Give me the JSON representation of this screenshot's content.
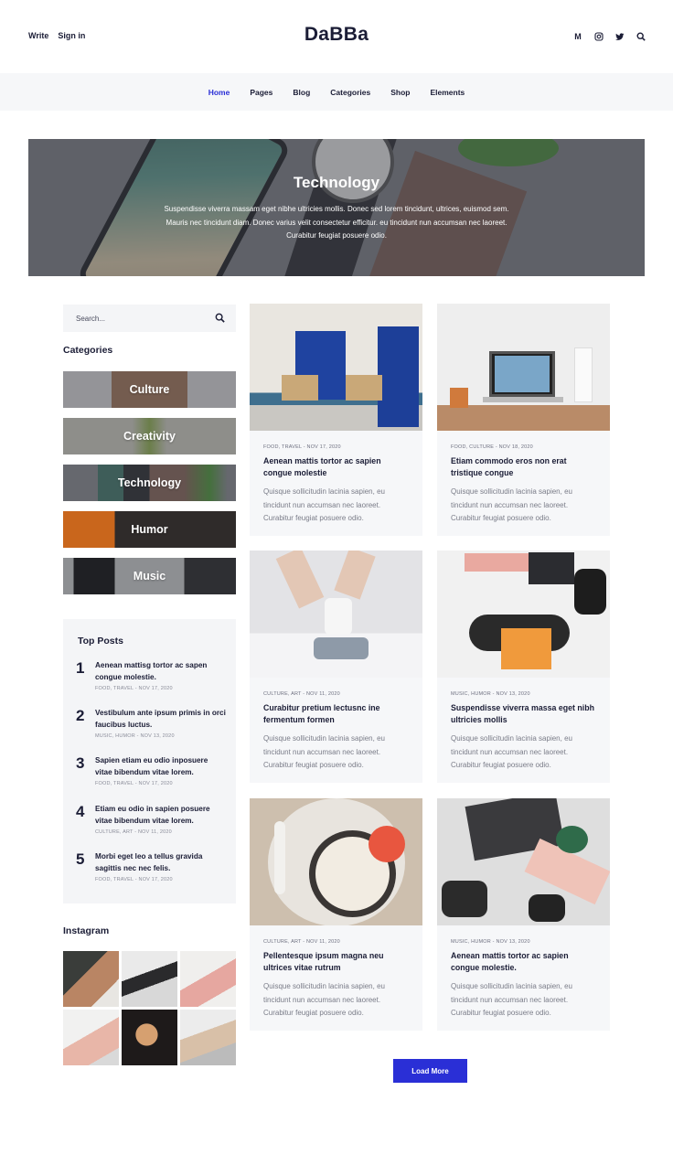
{
  "header": {
    "write_label": "Write",
    "signin_label": "Sign in",
    "logo": "DaBBa",
    "medium_glyph": "M"
  },
  "nav": {
    "items": [
      {
        "label": "Home",
        "active": true
      },
      {
        "label": "Pages"
      },
      {
        "label": "Blog"
      },
      {
        "label": "Categories"
      },
      {
        "label": "Shop"
      },
      {
        "label": "Elements"
      }
    ]
  },
  "hero": {
    "title": "Technology",
    "description": "Suspendisse viverra massam eget nibhe ultricies mollis. Donec sed lorem tincidunt, ultrices, euismod sem. Mauris nec tincidunt diam. Donec varius velit consectetur efficitur. eu tincidunt nun accumsan nec laoreet. Curabitur feugiat posuere odio."
  },
  "sidebar": {
    "search_placeholder": "Search...",
    "categories_heading": "Categories",
    "categories": [
      {
        "label": "Culture"
      },
      {
        "label": "Creativity"
      },
      {
        "label": "Technology"
      },
      {
        "label": "Humor"
      },
      {
        "label": "Music"
      }
    ],
    "top_posts_heading": "Top Posts",
    "top_posts": [
      {
        "num": "1",
        "title": "Aenean mattisg tortor ac sapen congue molestie.",
        "meta": "FOOD, TRAVEL - NOV 17, 2020"
      },
      {
        "num": "2",
        "title": "Vestibulum ante ipsum primis in orci faucibus luctus.",
        "meta": "MUSIC, HUMOR - NOV 13, 2020"
      },
      {
        "num": "3",
        "title": "Sapien  etiam eu odio inposuere vitae bibendum vitae lorem.",
        "meta": "FOOD, TRAVEL - NOV 17, 2020"
      },
      {
        "num": "4",
        "title": "Etiam eu odio in sapien posuere vitae bibendum vitae lorem.",
        "meta": "CULTURE, ART - NOV 11, 2020"
      },
      {
        "num": "5",
        "title": "Morbi eget leo a tellus gravida sagittis nec nec felis.",
        "meta": "FOOD, TRAVEL - NOV 17, 2020"
      }
    ],
    "instagram_heading": "Instagram"
  },
  "posts": [
    {
      "meta": "FOOD, TRAVEL - NOV 17, 2020",
      "title": "Aenean mattis tortor ac sapien congue molestie",
      "excerpt": "Quisque sollicitudin lacinia sapien, eu tincidunt nun accumsan nec laoreet. Curabitur feugiat posuere odio."
    },
    {
      "meta": "FOOD, CULTURE - NOV 18, 2020",
      "title": "Etiam commodo eros non erat tristique congue",
      "excerpt": "Quisque sollicitudin lacinia sapien, eu tincidunt nun accumsan nec laoreet. Curabitur feugiat posuere odio."
    },
    {
      "meta": "CULTURE, ART - NOV 11, 2020",
      "title": "Curabitur pretium lectusnc ine fermentum formen",
      "excerpt": "Quisque sollicitudin lacinia sapien, eu tincidunt nun accumsan nec laoreet. Curabitur feugiat posuere odio."
    },
    {
      "meta": "MUSIC, HUMOR - NOV 13, 2020",
      "title": "Suspendisse viverra massa eget nibh ultricies mollis",
      "excerpt": "Quisque sollicitudin lacinia sapien, eu tincidunt nun accumsan nec laoreet. Curabitur feugiat posuere odio."
    },
    {
      "meta": "CULTURE, ART - NOV 11, 2020",
      "title": "Pellentesque ipsum magna neu ultrices vitae rutrum",
      "excerpt": "Quisque sollicitudin lacinia sapien, eu tincidunt nun accumsan nec laoreet. Curabitur feugiat posuere odio."
    },
    {
      "meta": "MUSIC, HUMOR - NOV 13, 2020",
      "title": "Aenean mattis tortor ac sapien congue molestie.",
      "excerpt": "Quisque sollicitudin lacinia sapien, eu tincidunt nun accumsan nec laoreet. Curabitur feugiat posuere odio."
    }
  ],
  "load_more_label": "Load More",
  "colors": {
    "accent": "#2a2fd6",
    "text": "#1b1d36",
    "panel": "#f6f7f9"
  }
}
